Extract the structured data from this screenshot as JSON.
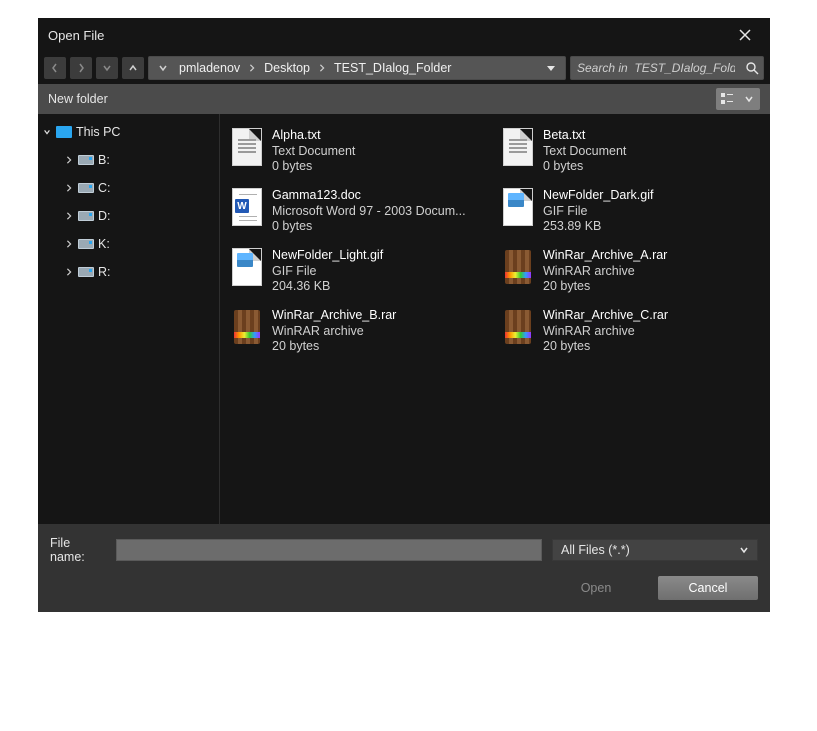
{
  "title": "Open File",
  "breadcrumb": {
    "items": [
      "pmladenov",
      "Desktop",
      "TEST_DIalog_Folder"
    ]
  },
  "search": {
    "placeholder": "Search in  TEST_DIalog_Folder"
  },
  "toolbar": {
    "new_folder": "New folder"
  },
  "tree": {
    "root_label": "This PC",
    "drives": [
      {
        "label": "B:"
      },
      {
        "label": "C:"
      },
      {
        "label": "D:"
      },
      {
        "label": "K:"
      },
      {
        "label": "R:"
      }
    ]
  },
  "files": [
    {
      "name": "Alpha.txt",
      "type": "Text Document",
      "size": "0 bytes",
      "icon": "txt"
    },
    {
      "name": "Beta.txt",
      "type": "Text Document",
      "size": "0 bytes",
      "icon": "txt"
    },
    {
      "name": "Gamma123.doc",
      "type": "Microsoft Word 97 - 2003 Docum...",
      "size": "0 bytes",
      "icon": "doc"
    },
    {
      "name": "NewFolder_Dark.gif",
      "type": "GIF File",
      "size": "253.89 KB",
      "icon": "gif"
    },
    {
      "name": "NewFolder_Light.gif",
      "type": "GIF File",
      "size": "204.36 KB",
      "icon": "gif"
    },
    {
      "name": "WinRar_Archive_A.rar",
      "type": "WinRAR archive",
      "size": "20 bytes",
      "icon": "rar"
    },
    {
      "name": "WinRar_Archive_B.rar",
      "type": "WinRAR archive",
      "size": "20 bytes",
      "icon": "rar"
    },
    {
      "name": "WinRar_Archive_C.rar",
      "type": "WinRAR archive",
      "size": "20 bytes",
      "icon": "rar"
    }
  ],
  "filename": {
    "label": "File name:",
    "value": ""
  },
  "filter": {
    "selected": "All Files (*.*)"
  },
  "buttons": {
    "open": "Open",
    "cancel": "Cancel"
  }
}
